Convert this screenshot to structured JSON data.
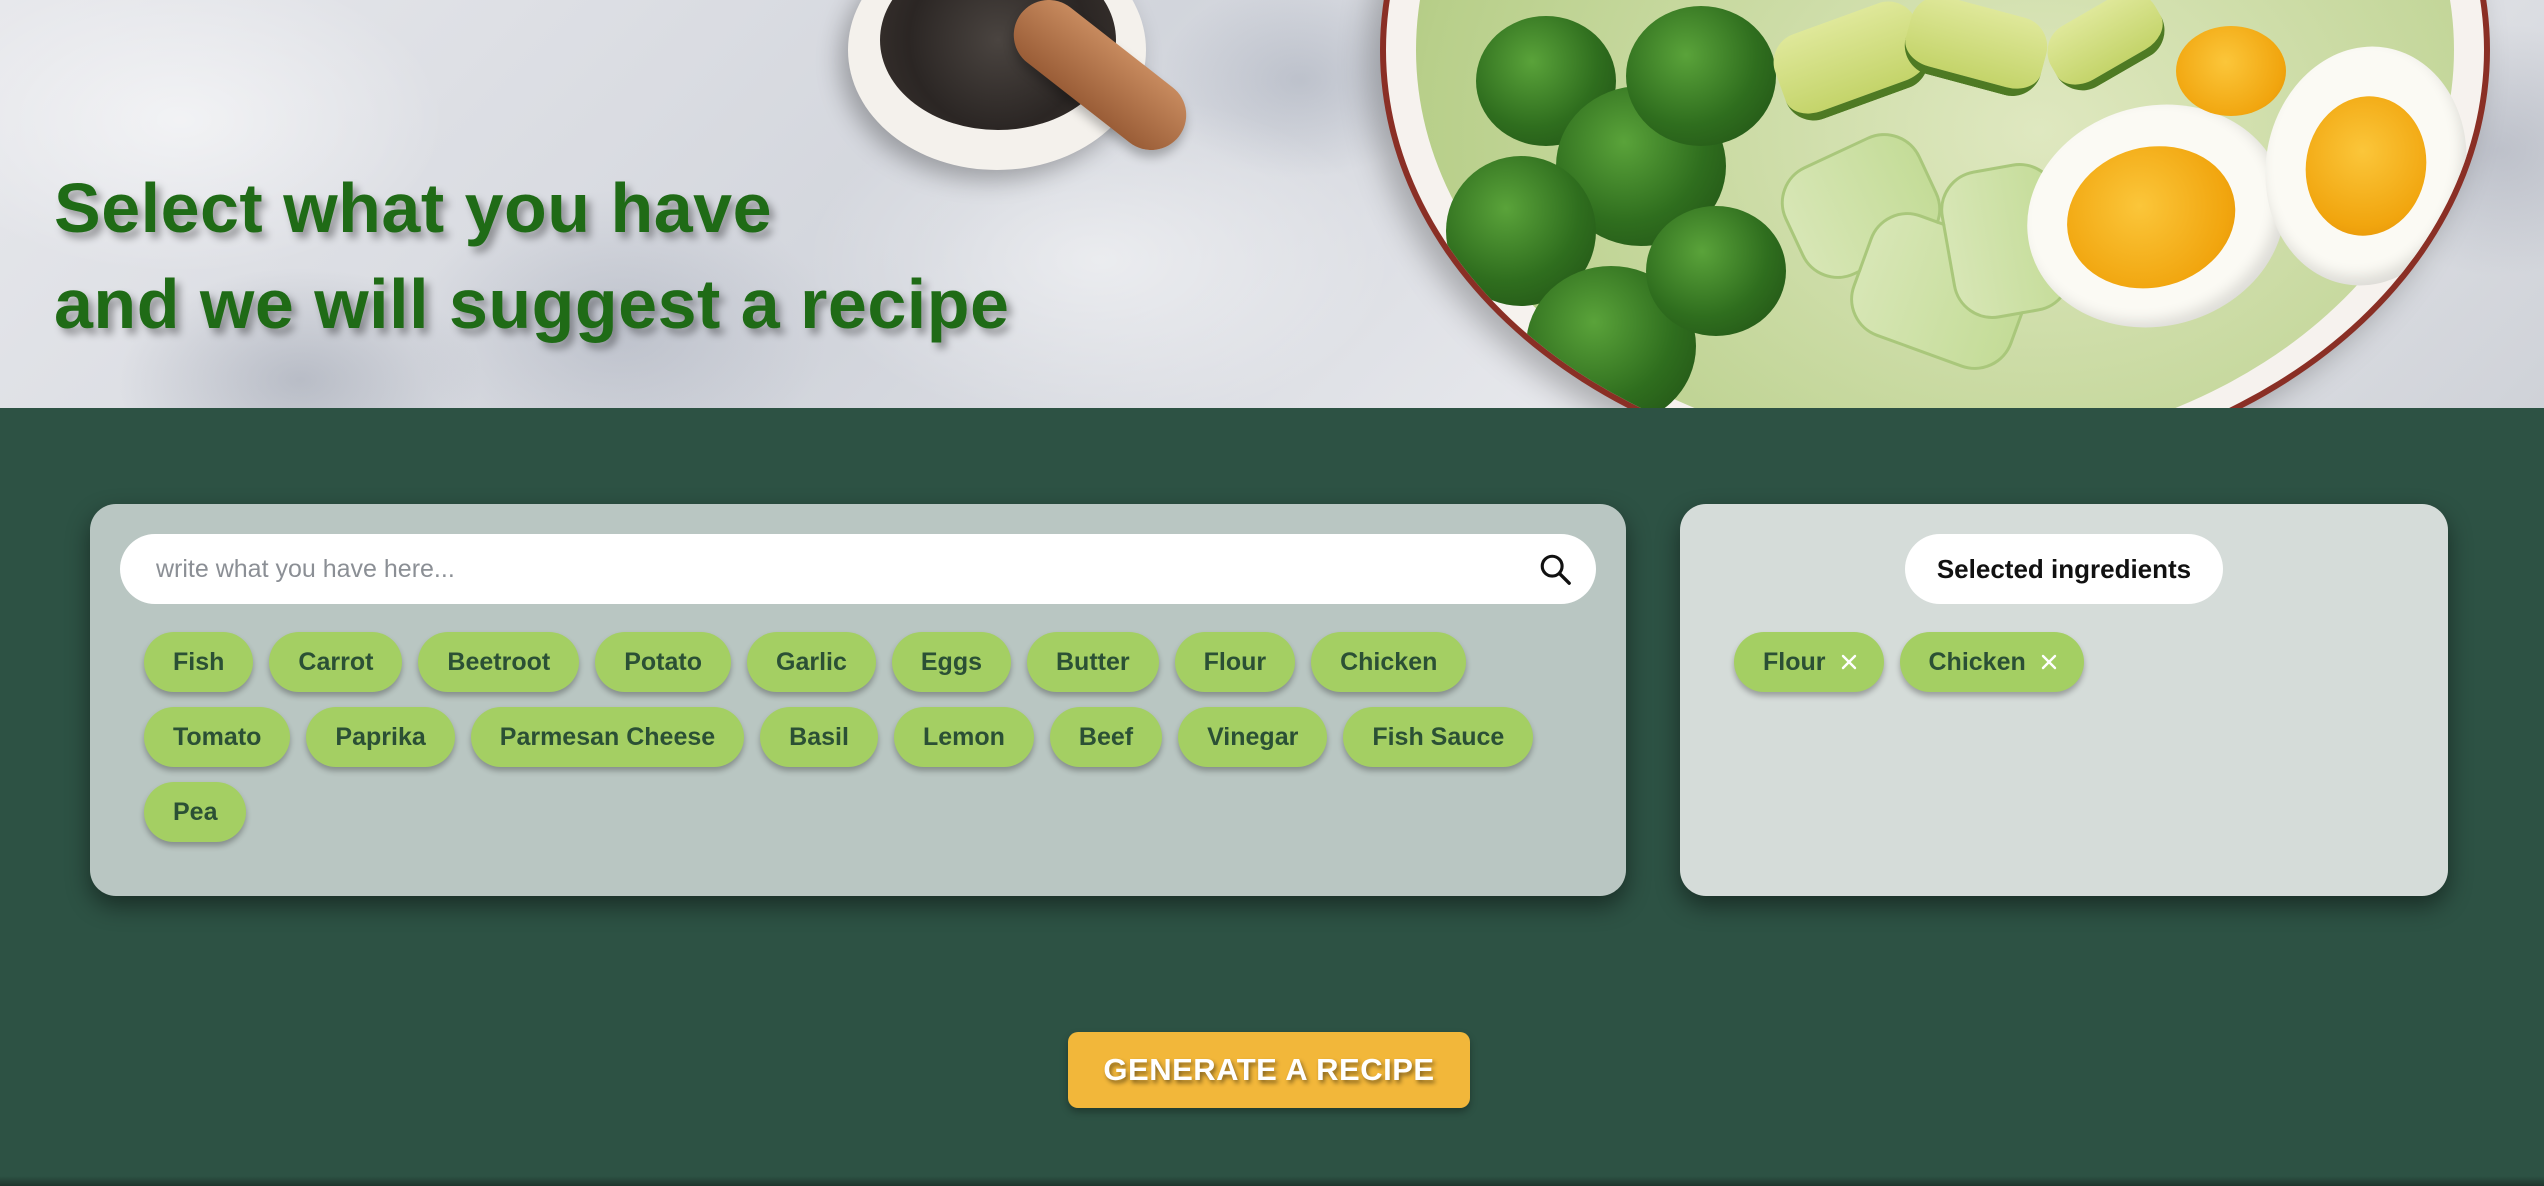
{
  "hero": {
    "title_line1": "Select what you have",
    "title_line2": "and we will suggest a recipe"
  },
  "search": {
    "placeholder": "write what you have here...",
    "value": "",
    "icon": "search-icon"
  },
  "ingredients": [
    "Fish",
    "Carrot",
    "Beetroot",
    "Potato",
    "Garlic",
    "Eggs",
    "Butter",
    "Flour",
    "Chicken",
    "Tomato",
    "Paprika",
    "Parmesan Cheese",
    "Basil",
    "Lemon",
    "Beef",
    "Vinegar",
    "Fish Sauce",
    "Pea"
  ],
  "selected": {
    "title": "Selected ingredients",
    "items": [
      "Flour",
      "Chicken"
    ],
    "remove_icon": "close-icon"
  },
  "actions": {
    "generate_label": "GENERATE A RECIPE"
  },
  "colors": {
    "background": "#2d5244",
    "chip": "#a4cf63",
    "chip_text": "#2b5035",
    "hero_title": "#1f6b16",
    "button": "#f2b73a",
    "left_panel": "#b9c6c2",
    "right_panel": "#d5dcd9"
  }
}
